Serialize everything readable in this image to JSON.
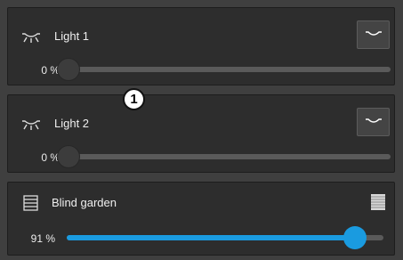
{
  "colors": {
    "accent": "#1a9be0",
    "card_bg": "#2d2d2d",
    "page_bg": "#3f3f3f",
    "track": "#5a5a5a"
  },
  "cards": [
    {
      "title": "Light 1",
      "icon": "ceiling-light-icon",
      "action_icon": "light-toggle-icon",
      "value_label": "0 %",
      "value": 0
    },
    {
      "title": "Light 2",
      "icon": "ceiling-light-icon",
      "action_icon": "light-toggle-icon",
      "value_label": "0 %",
      "value": 0
    },
    {
      "title": "Blind garden",
      "icon": "blind-icon",
      "action_icon": "blind-closed-icon",
      "value_label": "91 %",
      "value": 91
    }
  ],
  "marker": {
    "label": "1"
  }
}
